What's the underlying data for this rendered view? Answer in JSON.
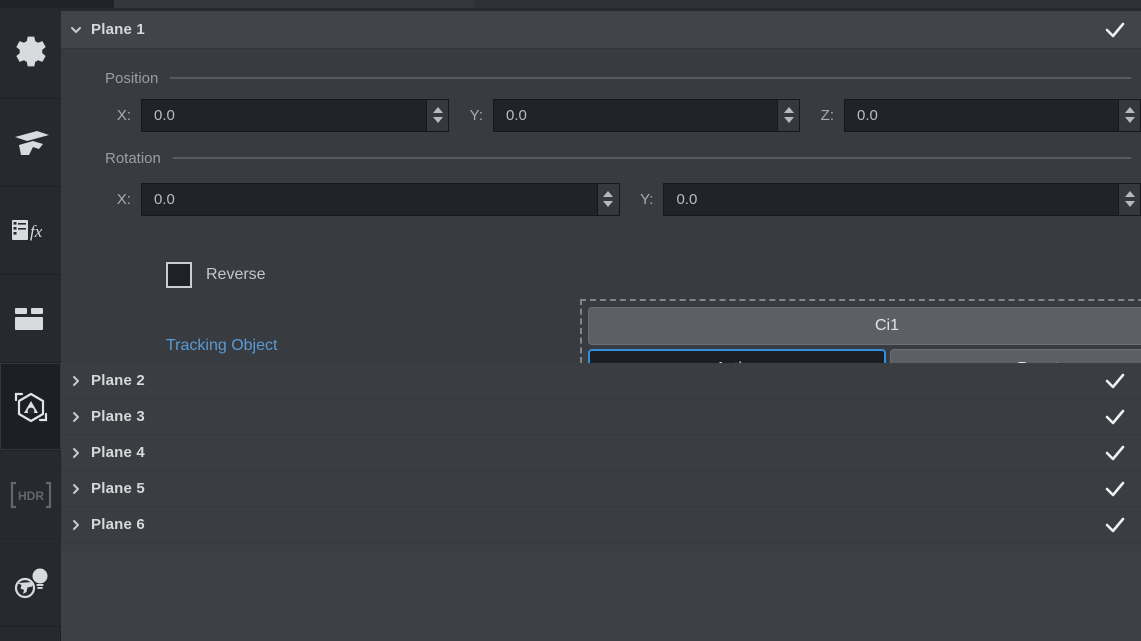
{
  "colors": {
    "panel_bg": "#3a3d42",
    "header_bg": "#41444a",
    "body_bg": "#383b40",
    "rail_bg": "#26292e",
    "input_bg": "#202328",
    "accent_blue": "#2f8fd8",
    "link_blue": "#5a9bd4",
    "button_gray": "#5c6066",
    "text_primary": "#d6d8da",
    "text_muted": "#9a9ea3"
  },
  "sidebar": {
    "items": [
      {
        "label": "Settings",
        "icon": "gear-icon",
        "active": false,
        "disabled": false
      },
      {
        "label": "Ground Plane",
        "icon": "ground-plane-icon",
        "active": false,
        "disabled": false
      },
      {
        "label": "Effects",
        "icon": "effects-fx-icon",
        "active": false,
        "disabled": false
      },
      {
        "label": "Camera Track",
        "icon": "film-slate-icon",
        "active": false,
        "disabled": false
      },
      {
        "label": "Object",
        "icon": "object-cube-icon",
        "active": true,
        "disabled": false
      },
      {
        "label": "HDR",
        "icon": "hdr-icon",
        "active": false,
        "disabled": true
      },
      {
        "label": "Environment Light",
        "icon": "globe-bulb-icon",
        "active": false,
        "disabled": false
      }
    ]
  },
  "main": {
    "expanded_plane": {
      "title": "Plane 1",
      "expand_icon": "chevron-down-icon",
      "check_icon": "check-icon",
      "position": {
        "label": "Position",
        "fields": [
          {
            "axis": "X:",
            "value": "0.0"
          },
          {
            "axis": "Y:",
            "value": "0.0"
          },
          {
            "axis": "Z:",
            "value": "0.0"
          }
        ]
      },
      "rotation": {
        "label": "Rotation",
        "fields": [
          {
            "axis": "X:",
            "value": "0.0"
          },
          {
            "axis": "Y:",
            "value": "0.0"
          }
        ]
      },
      "reverse": {
        "label": "Reverse",
        "checked": false
      },
      "tracking_object": {
        "label": "Tracking Object"
      },
      "tracking_controls": {
        "target_label": "Ci1",
        "active_label": "Active",
        "reset_label": "Reset"
      }
    },
    "collapsed_planes": [
      {
        "title": "Plane 2",
        "expand_icon": "chevron-right-icon",
        "check_icon": "check-icon"
      },
      {
        "title": "Plane 3",
        "expand_icon": "chevron-right-icon",
        "check_icon": "check-icon"
      },
      {
        "title": "Plane 4",
        "expand_icon": "chevron-right-icon",
        "check_icon": "check-icon"
      },
      {
        "title": "Plane 5",
        "expand_icon": "chevron-right-icon",
        "check_icon": "check-icon"
      },
      {
        "title": "Plane 6",
        "expand_icon": "chevron-right-icon",
        "check_icon": "check-icon"
      }
    ]
  }
}
